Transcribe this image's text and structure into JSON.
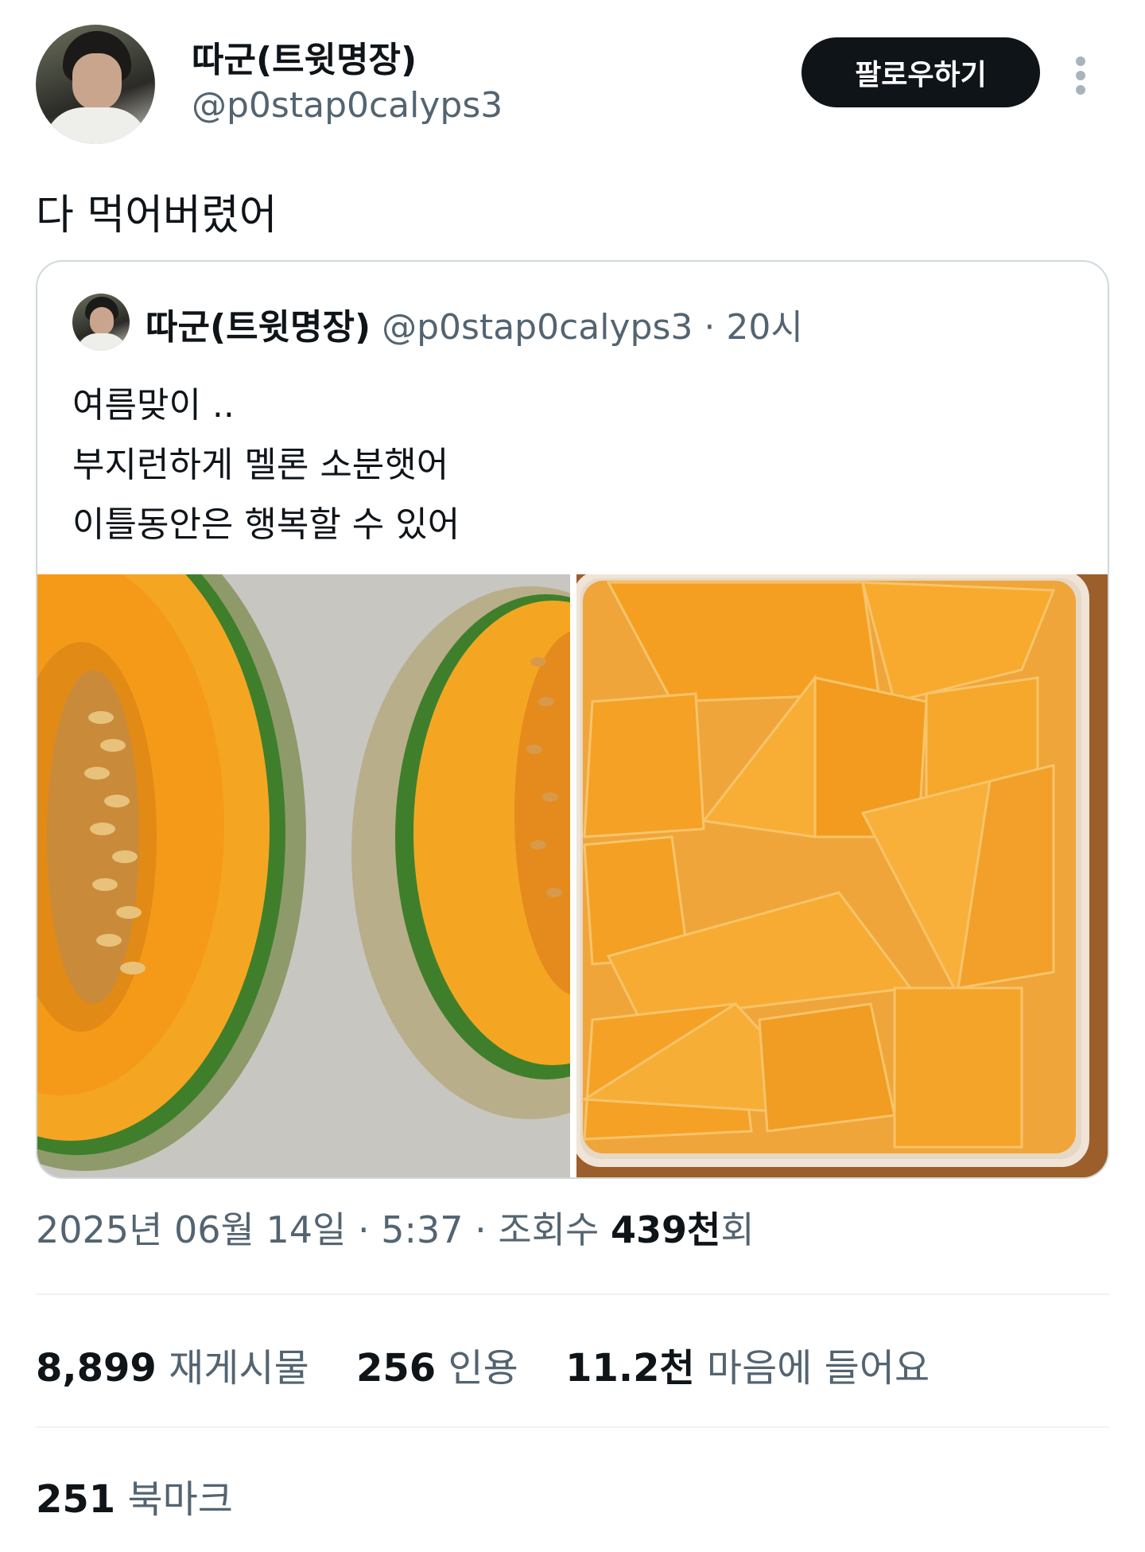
{
  "author": {
    "display_name": "따군(트윗명장)",
    "handle": "@p0stap0calyps3"
  },
  "actions": {
    "follow_label": "팔로우하기",
    "more_icon": "more-vertical-icon"
  },
  "tweet": {
    "text": "다 먹어버렸어",
    "date": "2025년 06월 14일",
    "sep1": " · ",
    "time": "5:37",
    "sep2": " · ",
    "views_label": "조회수 ",
    "views_count": "439천",
    "views_suffix": "회"
  },
  "quoted": {
    "display_name": "따군(트윗명장)",
    "handle": "@p0stap0calyps3",
    "time_sep": " · ",
    "time": "20시",
    "lines": [
      "여름맞이 ..",
      "부지런하게 멜론 소분햇어",
      "이틀동안은 행복할 수 있어"
    ]
  },
  "stats": {
    "reposts_count": "8,899",
    "reposts_label": "재게시물",
    "quotes_count": "256",
    "quotes_label": "인용",
    "likes_count": "11.2천",
    "likes_label": "마음에 들어요",
    "bookmarks_count": "251",
    "bookmarks_label": "북마크"
  },
  "colors": {
    "text": "#0f1419",
    "secondary": "#536471",
    "border": "#cfd9de",
    "follow_bg": "#0f1419",
    "melon_flesh": "#f4a020",
    "melon_rind": "#4c8a2a"
  }
}
